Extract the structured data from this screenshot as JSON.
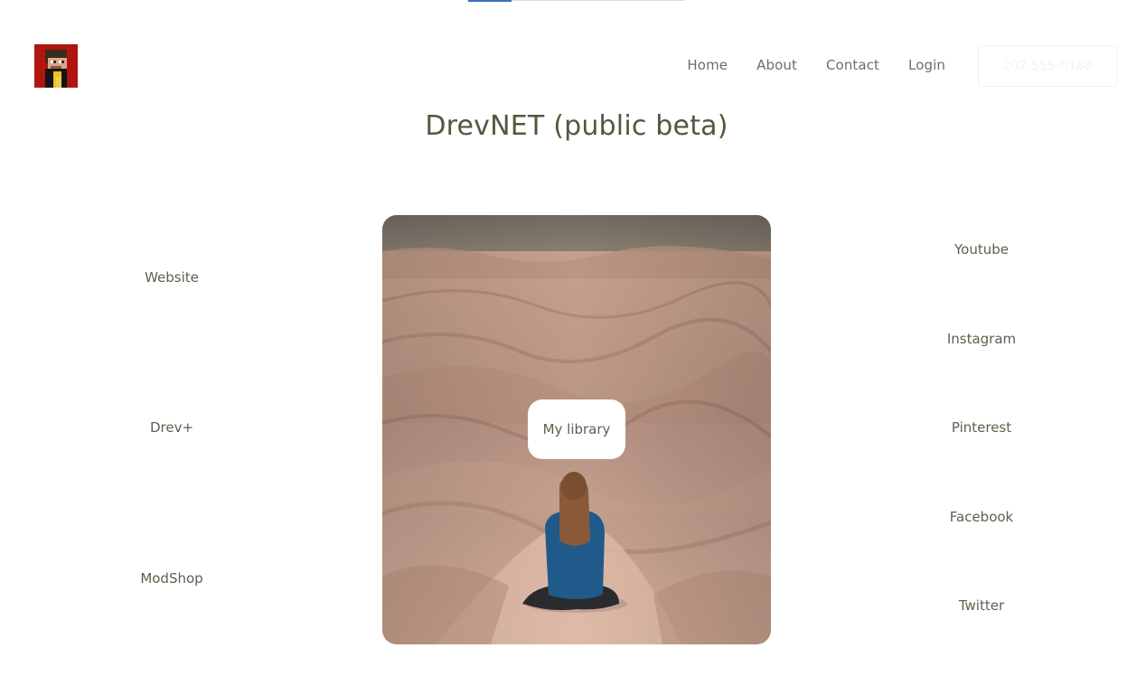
{
  "header": {
    "logo_name": "pixel-avatar-logo",
    "nav": {
      "home": "Home",
      "about": "About",
      "contact": "Contact",
      "login": "Login"
    },
    "phone": "202-555-0188"
  },
  "main": {
    "title": "DrevNET (public beta)",
    "left_links": [
      "Website",
      "Drev+",
      "ModShop"
    ],
    "right_links": [
      "Youtube",
      "Instagram",
      "Pinterest",
      "Facebook",
      "Twitter"
    ],
    "center_button": "My library"
  },
  "colors": {
    "accent": "#3b6fc4",
    "title": "#4e5a3d",
    "text": "#5e604f",
    "logo_bg": "#b0150f"
  }
}
